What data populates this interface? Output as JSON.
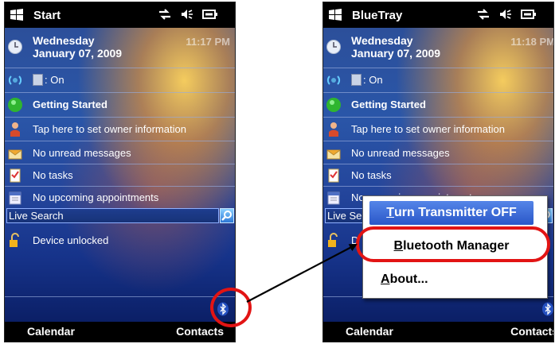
{
  "left_screen": {
    "title": "Start",
    "date_weekday": "Wednesday",
    "date_full": "January 07, 2009",
    "time": "11:17 PM",
    "radio_status": ": On",
    "getting_started": "Getting Started",
    "owner_info": "Tap here to set owner information",
    "messages": "No unread messages",
    "tasks": "No tasks",
    "appointments": "No upcoming appointments",
    "search_value": "Live Search",
    "device_lock": "Device unlocked",
    "softkey_left": "Calendar",
    "softkey_right": "Contacts"
  },
  "right_screen": {
    "title": "BlueTray",
    "date_weekday": "Wednesday",
    "date_full": "January 07, 2009",
    "time": "11:18 PM",
    "radio_status": ": On",
    "getting_started": "Getting Started",
    "owner_info": "Tap here to set owner information",
    "messages": "No unread messages",
    "tasks": "No tasks",
    "appointments": "No upcoming appointments",
    "search_value": "Live Se",
    "device_lock": "D",
    "softkey_left": "Calendar",
    "softkey_right": "Contacts"
  },
  "popup_menu": {
    "items": [
      {
        "label_first": "T",
        "label_rest": "urn Transmitter OFF",
        "selected": true
      },
      {
        "label_first": "B",
        "label_rest": "luetooth Manager",
        "selected": false
      },
      {
        "label_first": "A",
        "label_rest": "bout...",
        "selected": false
      }
    ]
  },
  "colors": {
    "highlight": "#e21414",
    "menu_selected": "#2a57c8",
    "title_bar": "#000000"
  },
  "icons": [
    "windows-flag-icon",
    "signal-icon",
    "speaker-icon",
    "battery-icon",
    "clock-icon",
    "wireless-icon",
    "bluetooth-icon",
    "getting-started-icon",
    "owner-icon",
    "mail-icon",
    "tasks-icon",
    "calendar-icon",
    "search-go-icon",
    "padlock-icon"
  ]
}
